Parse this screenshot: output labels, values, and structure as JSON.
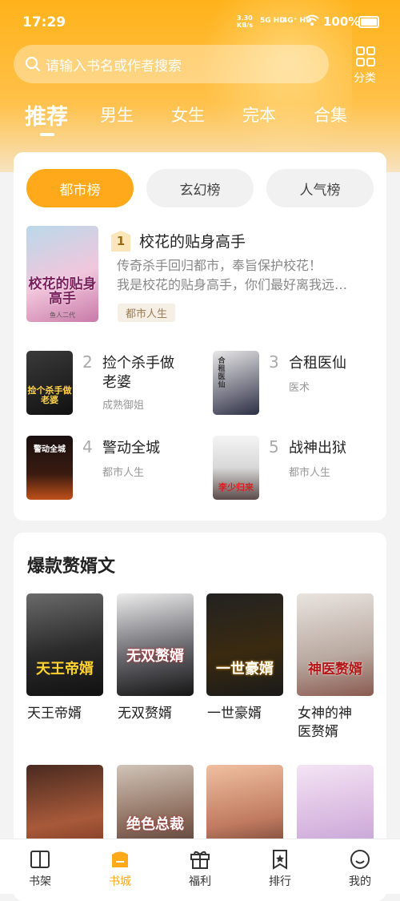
{
  "status": {
    "time": "17:29",
    "net_speed": "3.30",
    "net_unit": "KB/s",
    "sig1": "5G HD",
    "sig2": "4G⁺ HD",
    "battery": "100%"
  },
  "search": {
    "placeholder": "请输入书名或作者搜索"
  },
  "category": {
    "label": "分类"
  },
  "tabs": [
    "推荐",
    "男生",
    "女生",
    "完本",
    "合集"
  ],
  "rank": {
    "pills": [
      "都市榜",
      "玄幻榜",
      "人气榜"
    ],
    "top": {
      "rank": "1",
      "title": "校花的贴身高手",
      "desc1": "传奇杀手回归都市，奉旨保护校花！",
      "desc2": "我是校花的贴身高手，你们最好离我远…",
      "tag": "都市人生",
      "cover_text": "校花的贴身高手",
      "cover_author": "鱼人二代"
    },
    "items": [
      {
        "rank": "2",
        "title1": "捡个杀手做",
        "title2": "老婆",
        "sub": "成熟御姐",
        "cover_text": "捡个杀手做老婆"
      },
      {
        "rank": "3",
        "title1": "合租医仙",
        "title2": "",
        "sub": "医术",
        "cover_text": "合租医仙"
      },
      {
        "rank": "4",
        "title1": "警动全城",
        "title2": "",
        "sub": "都市人生",
        "cover_text": "警动全城"
      },
      {
        "rank": "5",
        "title1": "战神出狱",
        "title2": "",
        "sub": "都市人生",
        "cover_text": "李少归来"
      }
    ]
  },
  "section": {
    "title": "爆款赘婿文",
    "books": [
      {
        "t1": "天王帝婿",
        "t2": "",
        "cover_text": "天王帝婿"
      },
      {
        "t1": "无双赘婿",
        "t2": "",
        "cover_text": "无双赘婿"
      },
      {
        "t1": "一世豪婿",
        "t2": "",
        "cover_text": "一世豪婿"
      },
      {
        "t1": "女神的神",
        "t2": "医赘婿",
        "cover_text": "神医赘婿"
      },
      {
        "t1": "",
        "t2": "",
        "cover_text": ""
      },
      {
        "t1": "",
        "t2": "",
        "cover_text": "绝色总裁"
      },
      {
        "t1": "",
        "t2": "",
        "cover_text": ""
      },
      {
        "t1": "",
        "t2": "",
        "cover_text": ""
      }
    ]
  },
  "tabbar": [
    "书架",
    "书城",
    "福利",
    "排行",
    "我的"
  ],
  "colors": {
    "accent": "#ffa91b",
    "header": "#ffb21a"
  }
}
